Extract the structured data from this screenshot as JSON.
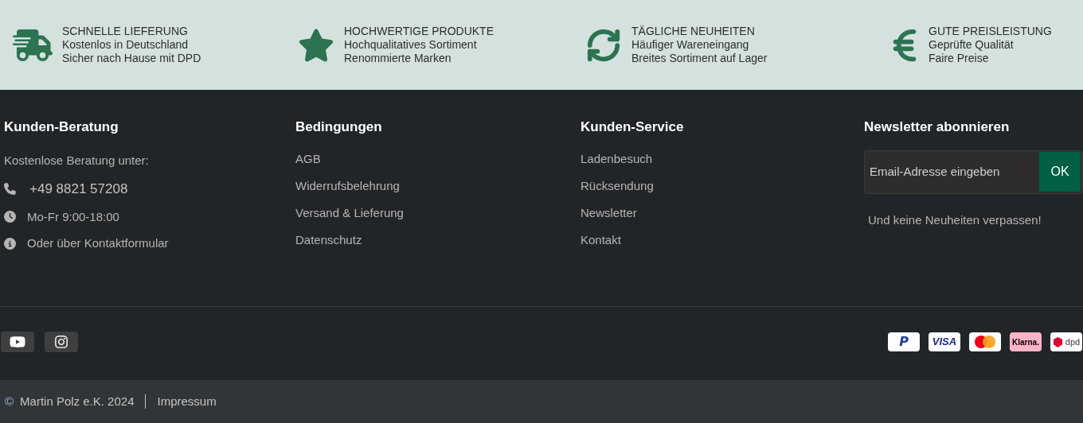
{
  "features": [
    {
      "kind": "truck",
      "title": "SCHNELLE LIEFERUNG",
      "lines": [
        "Kostenlos in Deutschland",
        "Sicher nach Hause mit DPD"
      ]
    },
    {
      "kind": "star",
      "title": "HOCHWERTIGE PRODUKTE",
      "lines": [
        "Hochqualitatives Sortiment",
        "Renommierte Marken"
      ]
    },
    {
      "kind": "refresh",
      "title": "TÄGLICHE NEUHEITEN",
      "lines": [
        "Häufiger Wareneingang",
        "Breites Sortiment auf Lager"
      ]
    },
    {
      "kind": "euro",
      "title": "GUTE PREISLEISTUNG",
      "lines": [
        "Geprüfte Qualität",
        "Faire Preise"
      ]
    }
  ],
  "contact": {
    "heading": "Kunden-Beratung",
    "intro": "Kostenlose Beratung unter:",
    "items": [
      {
        "kind": "phone",
        "text": "+49 8821 57208"
      },
      {
        "kind": "clock",
        "text": "Mo-Fr  9:00-18:00"
      },
      {
        "kind": "info",
        "text": "Oder über Kontaktformular"
      }
    ]
  },
  "link_columns": [
    {
      "heading": "Bedingungen",
      "links": [
        "AGB",
        "Widerrufsbelehrung",
        "Versand & Lieferung",
        "Datenschutz"
      ]
    },
    {
      "heading": "Kunden-Service",
      "links": [
        "Ladenbesuch",
        "Rücksendung",
        "Newsletter",
        "Kontakt"
      ]
    }
  ],
  "newsletter": {
    "heading": "Newsletter abonnieren",
    "placeholder": "Email-Adresse eingeben",
    "button": "OK",
    "note": "Und keine Neuheiten verpassen!"
  },
  "social": [
    {
      "kind": "youtube"
    },
    {
      "kind": "instagram"
    }
  ],
  "payments": [
    {
      "kind": "paypal",
      "label": "P"
    },
    {
      "kind": "visa",
      "label": "VISA"
    },
    {
      "kind": "mastercard"
    },
    {
      "kind": "klarna",
      "label": "Klarna."
    },
    {
      "kind": "dpd",
      "label": "dpd"
    }
  ],
  "bottom": {
    "copyright_sign": "©",
    "owner": "Martin Polz e.K. 2024",
    "link": "Impressum"
  }
}
